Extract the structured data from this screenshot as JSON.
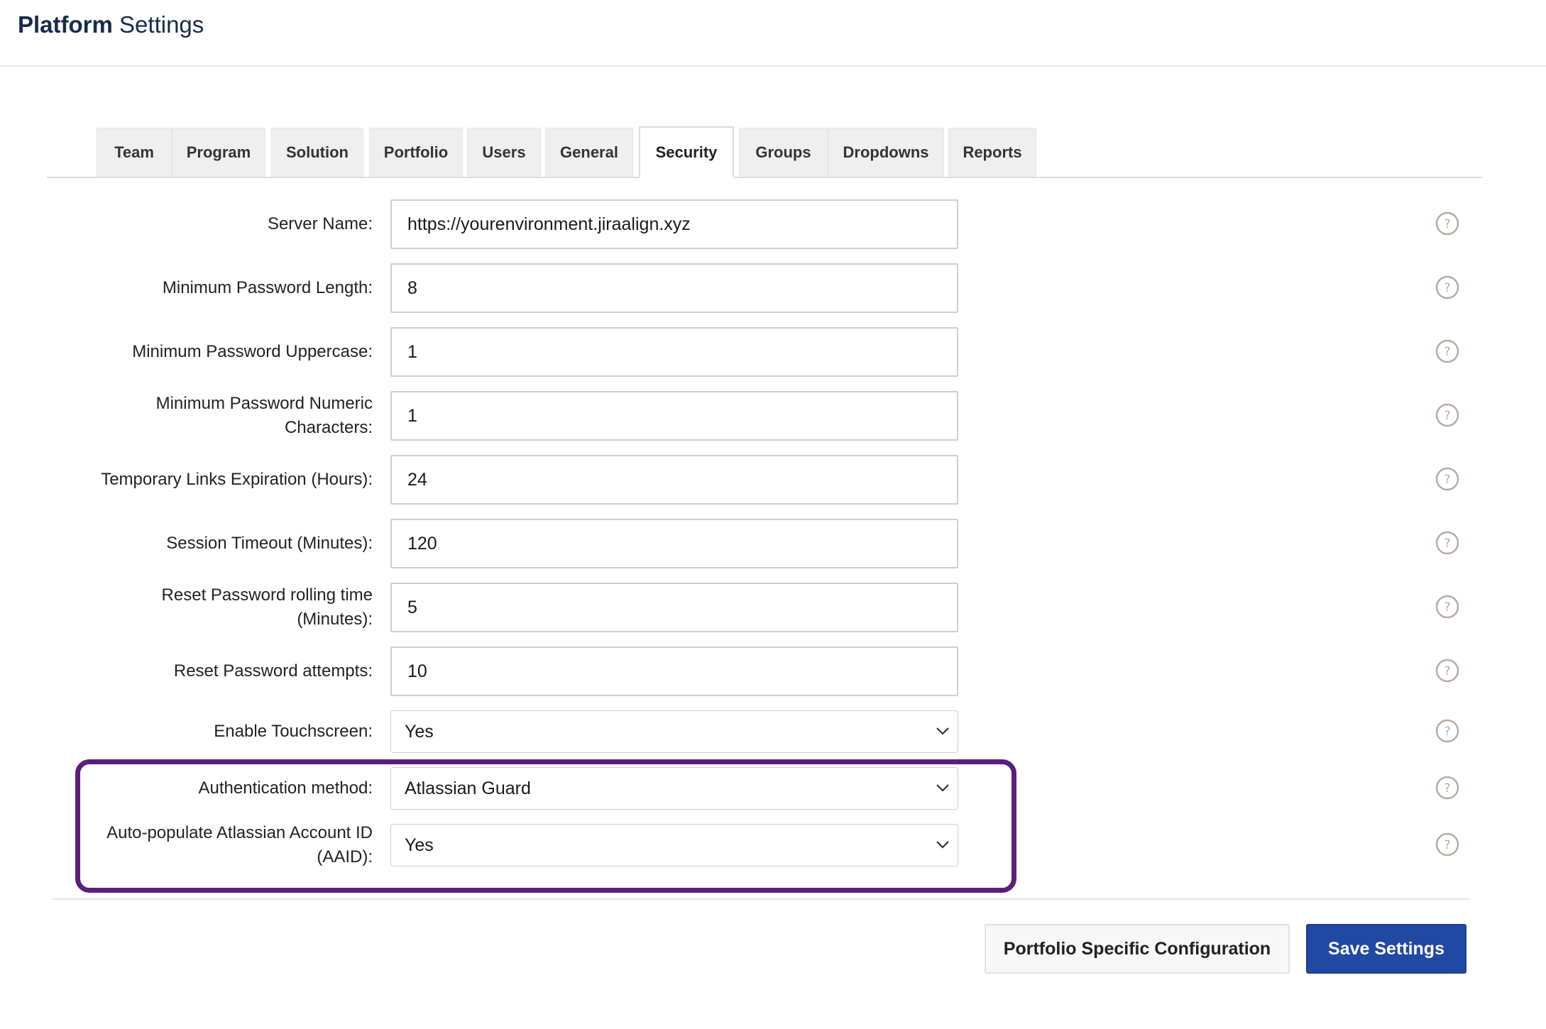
{
  "header": {
    "title_bold": "Platform",
    "title_light": "Settings"
  },
  "tabs": [
    {
      "label": "Team",
      "active": false
    },
    {
      "label": "Program",
      "active": false
    },
    {
      "label": "Solution",
      "active": false
    },
    {
      "label": "Portfolio",
      "active": false
    },
    {
      "label": "Users",
      "active": false
    },
    {
      "label": "General",
      "active": false
    },
    {
      "label": "Security",
      "active": true
    },
    {
      "label": "Groups",
      "active": false
    },
    {
      "label": "Dropdowns",
      "active": false
    },
    {
      "label": "Reports",
      "active": false
    }
  ],
  "fields": {
    "server_name": {
      "label": "Server Name:",
      "value": "https://yourenvironment.jiraalign.xyz"
    },
    "min_password_length": {
      "label": "Minimum Password Length:",
      "value": "8"
    },
    "min_password_uppercase": {
      "label": "Minimum Password Uppercase:",
      "value": "1"
    },
    "min_password_numeric": {
      "label_line1": "Minimum Password Numeric",
      "label_line2": "Characters:",
      "value": "1"
    },
    "temp_links_expiration": {
      "label": "Temporary Links Expiration (Hours):",
      "value": "24"
    },
    "session_timeout": {
      "label": "Session Timeout (Minutes):",
      "value": "120"
    },
    "reset_password_rolling": {
      "label_line1": "Reset Password rolling time",
      "label_line2": "(Minutes):",
      "value": "5"
    },
    "reset_password_attempts": {
      "label": "Reset Password attempts:",
      "value": "10"
    },
    "enable_touchscreen": {
      "label": "Enable Touchscreen:",
      "value": "Yes"
    },
    "authentication_method": {
      "label": "Authentication method:",
      "value": "Atlassian Guard"
    },
    "auto_populate_aaid": {
      "label_line1": "Auto-populate Atlassian Account ID",
      "label_line2": "(AAID):",
      "value": "Yes"
    }
  },
  "buttons": {
    "portfolio_config": "Portfolio Specific Configuration",
    "save": "Save Settings"
  },
  "colors": {
    "highlight_border": "#5a1f7d",
    "primary_button": "#2148a3",
    "title": "#172b4d"
  },
  "icons": {
    "help": "question-circle-icon",
    "dropdown": "chevron-down-icon"
  }
}
